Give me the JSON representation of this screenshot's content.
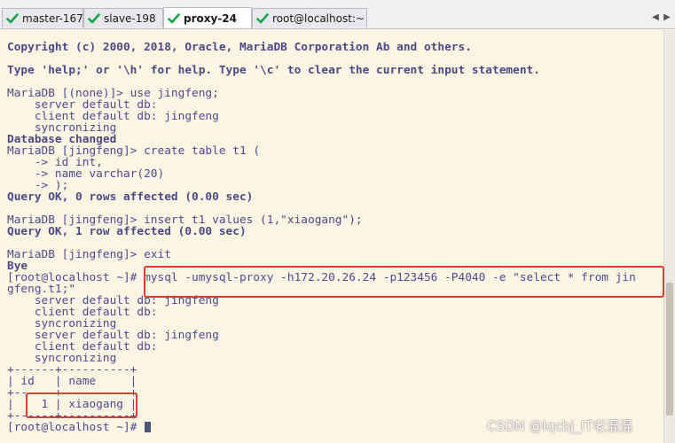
{
  "tabs": [
    {
      "label": "master-167",
      "active": false
    },
    {
      "label": "slave-198",
      "active": false
    },
    {
      "label": "proxy-24",
      "active": true
    },
    {
      "label": "root@localhost:~",
      "active": false
    }
  ],
  "tab_nav": {
    "prev": "◀",
    "next": "▶"
  },
  "terminal": {
    "lines": [
      {
        "text": "Copyright (c) 2000, 2018, Oracle, MariaDB Corporation Ab and others.",
        "bold": true
      },
      {
        "text": "",
        "bold": false
      },
      {
        "text": "Type 'help;' or '\\h' for help. Type '\\c' to clear the current input statement.",
        "bold": true
      },
      {
        "text": "",
        "bold": false
      },
      {
        "text": "MariaDB [(none)]> use jingfeng;",
        "bold": false
      },
      {
        "text": "    server default db:",
        "bold": false
      },
      {
        "text": "    client default db: jingfeng",
        "bold": false
      },
      {
        "text": "    syncronizing",
        "bold": false
      },
      {
        "text": "Database changed",
        "bold": true
      },
      {
        "text": "MariaDB [jingfeng]> create table t1 (",
        "bold": false
      },
      {
        "text": "    -> id int,",
        "bold": false
      },
      {
        "text": "    -> name varchar(20)",
        "bold": false
      },
      {
        "text": "    -> );",
        "bold": false
      },
      {
        "text": "Query OK, 0 rows affected (0.00 sec)",
        "bold": true
      },
      {
        "text": "",
        "bold": false
      },
      {
        "text": "MariaDB [jingfeng]> insert t1 values (1,\"xiaogang\");",
        "bold": false
      },
      {
        "text": "Query OK, 1 row affected (0.00 sec)",
        "bold": true
      },
      {
        "text": "",
        "bold": false
      },
      {
        "text": "MariaDB [jingfeng]> exit",
        "bold": false
      },
      {
        "text": "Bye",
        "bold": true
      },
      {
        "text": "[root@localhost ~]# mysql -umysql-proxy -h172.20.26.24 -p123456 -P4040 -e \"select * from jin",
        "bold": false
      },
      {
        "text": "gfeng.t1;\"",
        "bold": false
      },
      {
        "text": "    server default db: jingfeng",
        "bold": false
      },
      {
        "text": "    client default db:",
        "bold": false
      },
      {
        "text": "    syncronizing",
        "bold": false
      },
      {
        "text": "    server default db: jingfeng",
        "bold": false
      },
      {
        "text": "    client default db:",
        "bold": false
      },
      {
        "text": "    syncronizing",
        "bold": false
      },
      {
        "text": "+------+----------+",
        "bold": false
      },
      {
        "text": "| id   | name     |",
        "bold": false
      },
      {
        "text": "+------+----------+",
        "bold": false
      },
      {
        "text": "|    1 | xiaogang |",
        "bold": false
      },
      {
        "text": "+------+----------+",
        "bold": false
      },
      {
        "text": "[root@localhost ~]# ",
        "bold": false
      }
    ]
  },
  "colors": {
    "terminal_bg": "#fcf5e3",
    "terminal_text": "#4b4b8f",
    "highlight_box": "#e23b2f",
    "tab_check": "#1aa34a"
  },
  "watermark": "CSDN @lqcbj_IT老混混"
}
